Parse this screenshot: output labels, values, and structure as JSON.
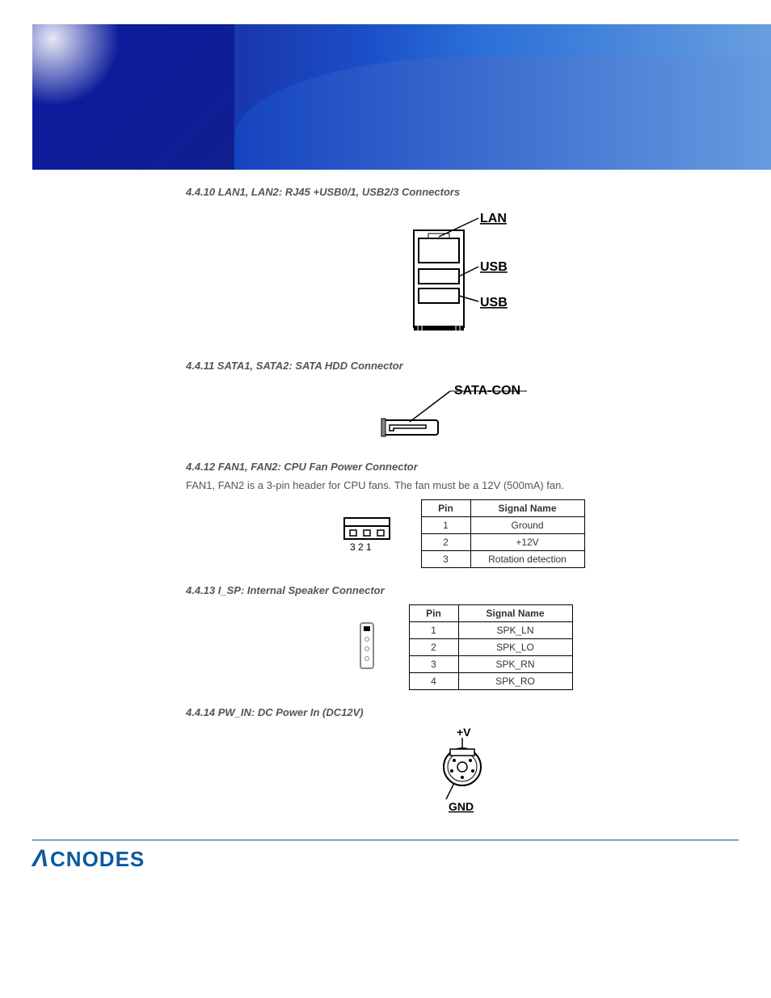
{
  "sections": {
    "s1": {
      "title": "4.4.10 LAN1, LAN2: RJ45 +USB0/1, USB2/3 Connectors"
    },
    "s2": {
      "title": "4.4.11 SATA1, SATA2: SATA HDD Connector"
    },
    "s3": {
      "title": "4.4.12 FAN1, FAN2: CPU Fan Power Connector",
      "desc": "FAN1, FAN2 is a 3-pin header for CPU fans. The fan must be a 12V (500mA) fan."
    },
    "s4": {
      "title": "4.4.13 I_SP: Internal Speaker Connector"
    },
    "s5": {
      "title": "4.4.14 PW_IN: DC Power In (DC12V)"
    }
  },
  "diagrams": {
    "lanusb": {
      "lan": "LAN",
      "usb1": "USB",
      "usb2": "USB"
    },
    "sata": {
      "label": "SATA-CON"
    },
    "fan": {
      "pins": "3 2 1"
    },
    "power": {
      "plus": "+V",
      "gnd": "GND"
    }
  },
  "table_headers": {
    "pin": "Pin",
    "signal": "Signal Name"
  },
  "fan_table": [
    {
      "pin": "1",
      "signal": "Ground"
    },
    {
      "pin": "2",
      "signal": "+12V"
    },
    {
      "pin": "3",
      "signal": "Rotation detection"
    }
  ],
  "isp_table": [
    {
      "pin": "1",
      "signal": "SPK_LN"
    },
    {
      "pin": "2",
      "signal": "SPK_LO"
    },
    {
      "pin": "3",
      "signal": "SPK_RN"
    },
    {
      "pin": "4",
      "signal": "SPK_RO"
    }
  ],
  "footer": {
    "brand": "CNODES"
  }
}
